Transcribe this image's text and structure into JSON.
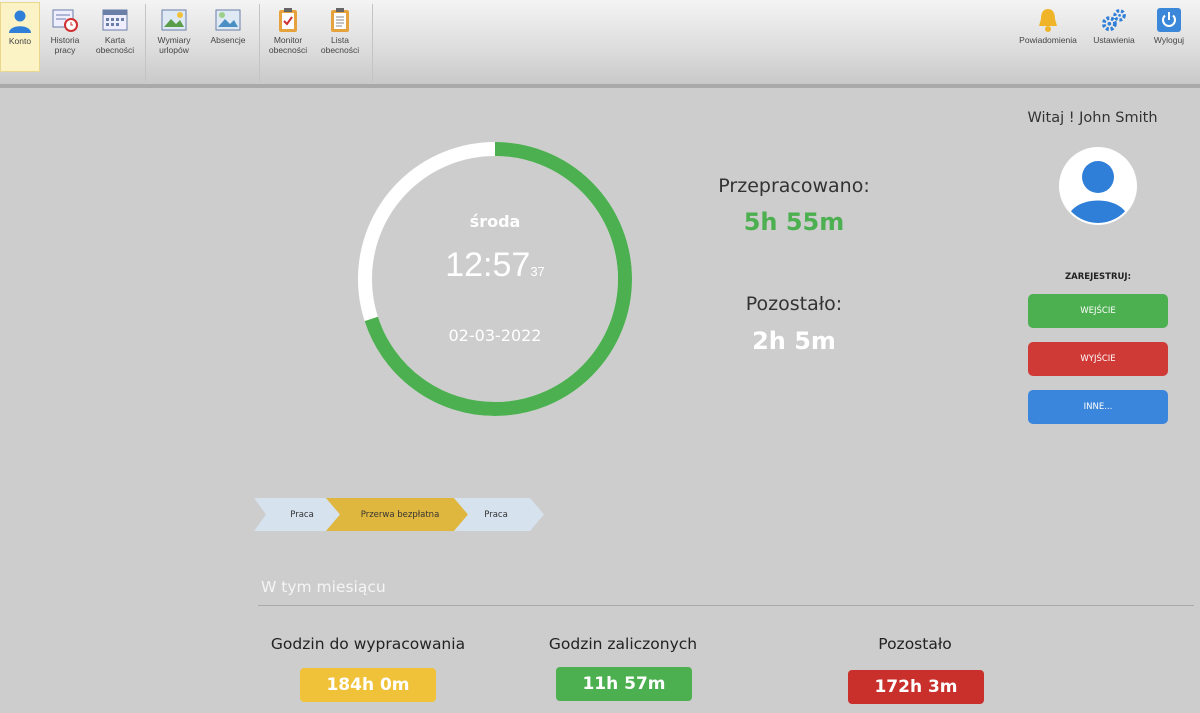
{
  "toolbar": {
    "items": [
      {
        "label": "Konto",
        "icon": "user-icon"
      },
      {
        "label": "Historia pracy",
        "icon": "history-icon"
      },
      {
        "label": "Karta obecności",
        "icon": "calendar-icon"
      },
      {
        "label": "Wymiary urlopów",
        "icon": "vacation-icon"
      },
      {
        "label": "Absencje",
        "icon": "absence-icon"
      },
      {
        "label": "Monitor obecności",
        "icon": "clipboard-check-icon"
      },
      {
        "label": "Lista obecności",
        "icon": "clipboard-list-icon"
      }
    ],
    "right": [
      {
        "label": "Powiadomienia",
        "icon": "bell-icon"
      },
      {
        "label": "Ustawienia",
        "icon": "gears-icon"
      },
      {
        "label": "Wyloguj",
        "icon": "power-icon"
      }
    ]
  },
  "greeting": "Witaj ! John Smith",
  "clock": {
    "day": "środa",
    "time": "12:57",
    "seconds": "37",
    "date": "02-03-2022",
    "progress": 0.7,
    "colors": {
      "done": "#4caf50",
      "rest": "#ffffff"
    }
  },
  "worked": {
    "label": "Przepracowano:",
    "value": "5h 55m"
  },
  "remaining": {
    "label": "Pozostało:",
    "value": "2h 5m"
  },
  "register": {
    "label": "ZAREJESTRUJ:",
    "enter": "WEJŚCIE",
    "exit": "WYJŚCIE",
    "other": "INNE..."
  },
  "timeline": [
    {
      "label": "Praca",
      "color": "#d6e2ee"
    },
    {
      "label": "Przerwa bezpłatna",
      "color": "#e0b73e"
    },
    {
      "label": "Praca",
      "color": "#d6e2ee"
    }
  ],
  "month": {
    "title": "W tym miesiącu",
    "to_work": {
      "label": "Godzin do wypracowania",
      "value": "184h 0m",
      "color": "#f0c23a"
    },
    "credited": {
      "label": "Godzin zaliczonych",
      "value": "11h 57m",
      "color": "#4caf50"
    },
    "left": {
      "label": "Pozostało",
      "value": "172h 3m",
      "color": "#c9302c"
    }
  }
}
